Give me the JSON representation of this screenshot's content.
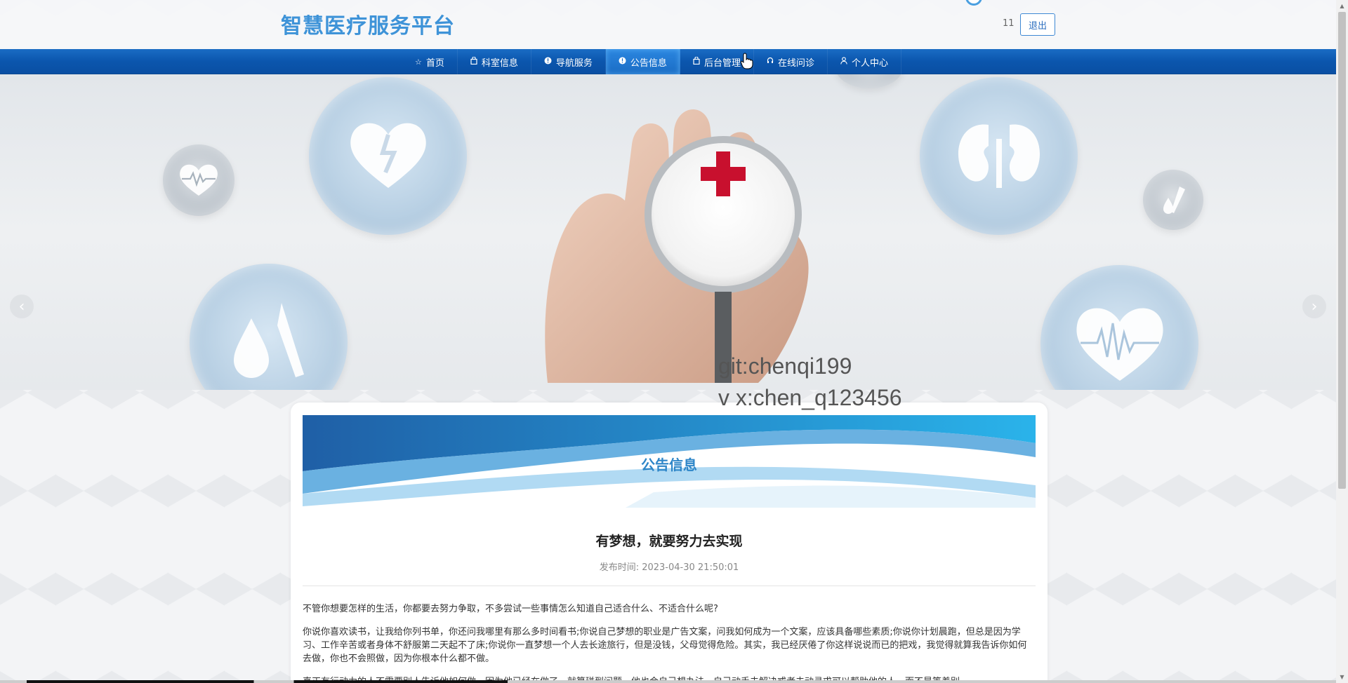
{
  "header": {
    "site_title": "智慧医疗服务平台",
    "username": "11",
    "logout_label": "退出"
  },
  "nav": {
    "items": [
      {
        "label": "首页",
        "icon": "star-icon"
      },
      {
        "label": "科室信息",
        "icon": "bag-icon"
      },
      {
        "label": "导航服务",
        "icon": "info-icon"
      },
      {
        "label": "公告信息",
        "icon": "info-icon"
      },
      {
        "label": "后台管理",
        "icon": "bag-icon"
      },
      {
        "label": "在线问诊",
        "icon": "headset-icon"
      },
      {
        "label": "个人中心",
        "icon": "user-icon"
      }
    ],
    "active_index": 3
  },
  "banner": {
    "prev_label": "‹",
    "next_label": "›"
  },
  "watermark": {
    "line1": "git:chenqi199",
    "line2": "v x:chen_q123456"
  },
  "notice": {
    "section_title": "公告信息",
    "article_title": "有梦想，就要努力去实现",
    "publish_label": "发布时间:",
    "publish_time": "2023-04-30 21:50:01",
    "paragraphs": [
      "不管你想要怎样的生活，你都要去努力争取，不多尝试一些事情怎么知道自己适合什么、不适合什么呢?",
      "你说你喜欢读书，让我给你列书单，你还问我哪里有那么多时间看书;你说自己梦想的职业是广告文案，问我如何成为一个文案，应该具备哪些素质;你说你计划晨跑，但总是因为学习、工作辛苦或者身体不舒服第二天起不了床;你说你一直梦想一个人去长途旅行，但是没钱，父母觉得危险。其实，我已经厌倦了你这样说说而已的把戏，我觉得就算我告诉你如何去做，你也不会照做，因为你根本什么都不做。",
      "真正有行动力的人不需要别人告诉他如何做，因为他已经在做了。就算碰到问题，他也会自己想办法，自己动手去解决或者去动寻求可以帮助他的人，而不是等着别"
    ]
  },
  "colors": {
    "brand": "#3e93d8",
    "nav_bg": "#0b56ad",
    "section_title": "#2e86c8"
  }
}
